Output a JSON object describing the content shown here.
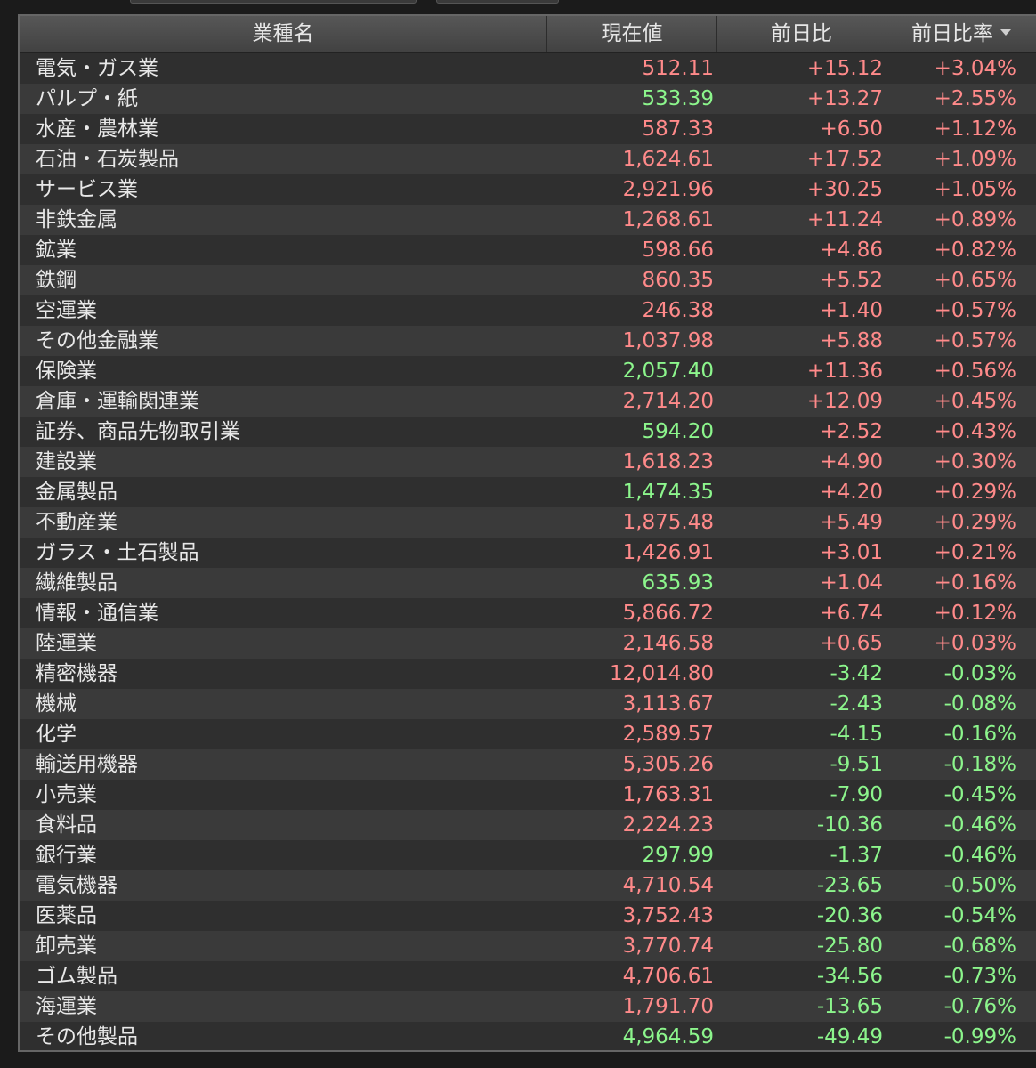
{
  "columns": {
    "name": "業種名",
    "price": "現在値",
    "change": "前日比",
    "change_pct": "前日比率"
  },
  "colors": {
    "up": "#ff8a8a",
    "down": "#8cf58c"
  },
  "rows": [
    {
      "name": "電気・ガス業",
      "price": "512.11",
      "price_dir": "up",
      "change": "+15.12",
      "change_pct": "+3.04%",
      "dir": "up"
    },
    {
      "name": "パルプ・紙",
      "price": "533.39",
      "price_dir": "down",
      "change": "+13.27",
      "change_pct": "+2.55%",
      "dir": "up"
    },
    {
      "name": "水産・農林業",
      "price": "587.33",
      "price_dir": "up",
      "change": "+6.50",
      "change_pct": "+1.12%",
      "dir": "up"
    },
    {
      "name": "石油・石炭製品",
      "price": "1,624.61",
      "price_dir": "up",
      "change": "+17.52",
      "change_pct": "+1.09%",
      "dir": "up"
    },
    {
      "name": "サービス業",
      "price": "2,921.96",
      "price_dir": "up",
      "change": "+30.25",
      "change_pct": "+1.05%",
      "dir": "up"
    },
    {
      "name": "非鉄金属",
      "price": "1,268.61",
      "price_dir": "up",
      "change": "+11.24",
      "change_pct": "+0.89%",
      "dir": "up"
    },
    {
      "name": "鉱業",
      "price": "598.66",
      "price_dir": "up",
      "change": "+4.86",
      "change_pct": "+0.82%",
      "dir": "up"
    },
    {
      "name": "鉄鋼",
      "price": "860.35",
      "price_dir": "up",
      "change": "+5.52",
      "change_pct": "+0.65%",
      "dir": "up"
    },
    {
      "name": "空運業",
      "price": "246.38",
      "price_dir": "up",
      "change": "+1.40",
      "change_pct": "+0.57%",
      "dir": "up"
    },
    {
      "name": "その他金融業",
      "price": "1,037.98",
      "price_dir": "up",
      "change": "+5.88",
      "change_pct": "+0.57%",
      "dir": "up"
    },
    {
      "name": "保険業",
      "price": "2,057.40",
      "price_dir": "down",
      "change": "+11.36",
      "change_pct": "+0.56%",
      "dir": "up"
    },
    {
      "name": "倉庫・運輸関連業",
      "price": "2,714.20",
      "price_dir": "up",
      "change": "+12.09",
      "change_pct": "+0.45%",
      "dir": "up"
    },
    {
      "name": "証券、商品先物取引業",
      "price": "594.20",
      "price_dir": "down",
      "change": "+2.52",
      "change_pct": "+0.43%",
      "dir": "up"
    },
    {
      "name": "建設業",
      "price": "1,618.23",
      "price_dir": "up",
      "change": "+4.90",
      "change_pct": "+0.30%",
      "dir": "up"
    },
    {
      "name": "金属製品",
      "price": "1,474.35",
      "price_dir": "down",
      "change": "+4.20",
      "change_pct": "+0.29%",
      "dir": "up"
    },
    {
      "name": "不動産業",
      "price": "1,875.48",
      "price_dir": "up",
      "change": "+5.49",
      "change_pct": "+0.29%",
      "dir": "up"
    },
    {
      "name": "ガラス・土石製品",
      "price": "1,426.91",
      "price_dir": "up",
      "change": "+3.01",
      "change_pct": "+0.21%",
      "dir": "up"
    },
    {
      "name": "繊維製品",
      "price": "635.93",
      "price_dir": "down",
      "change": "+1.04",
      "change_pct": "+0.16%",
      "dir": "up"
    },
    {
      "name": "情報・通信業",
      "price": "5,866.72",
      "price_dir": "up",
      "change": "+6.74",
      "change_pct": "+0.12%",
      "dir": "up"
    },
    {
      "name": "陸運業",
      "price": "2,146.58",
      "price_dir": "up",
      "change": "+0.65",
      "change_pct": "+0.03%",
      "dir": "up"
    },
    {
      "name": "精密機器",
      "price": "12,014.80",
      "price_dir": "up",
      "change": "-3.42",
      "change_pct": "-0.03%",
      "dir": "down"
    },
    {
      "name": "機械",
      "price": "3,113.67",
      "price_dir": "up",
      "change": "-2.43",
      "change_pct": "-0.08%",
      "dir": "down"
    },
    {
      "name": "化学",
      "price": "2,589.57",
      "price_dir": "up",
      "change": "-4.15",
      "change_pct": "-0.16%",
      "dir": "down"
    },
    {
      "name": "輸送用機器",
      "price": "5,305.26",
      "price_dir": "up",
      "change": "-9.51",
      "change_pct": "-0.18%",
      "dir": "down"
    },
    {
      "name": "小売業",
      "price": "1,763.31",
      "price_dir": "up",
      "change": "-7.90",
      "change_pct": "-0.45%",
      "dir": "down"
    },
    {
      "name": "食料品",
      "price": "2,224.23",
      "price_dir": "up",
      "change": "-10.36",
      "change_pct": "-0.46%",
      "dir": "down"
    },
    {
      "name": "銀行業",
      "price": "297.99",
      "price_dir": "down",
      "change": "-1.37",
      "change_pct": "-0.46%",
      "dir": "down"
    },
    {
      "name": "電気機器",
      "price": "4,710.54",
      "price_dir": "up",
      "change": "-23.65",
      "change_pct": "-0.50%",
      "dir": "down"
    },
    {
      "name": "医薬品",
      "price": "3,752.43",
      "price_dir": "up",
      "change": "-20.36",
      "change_pct": "-0.54%",
      "dir": "down"
    },
    {
      "name": "卸売業",
      "price": "3,770.74",
      "price_dir": "up",
      "change": "-25.80",
      "change_pct": "-0.68%",
      "dir": "down"
    },
    {
      "name": "ゴム製品",
      "price": "4,706.61",
      "price_dir": "up",
      "change": "-34.56",
      "change_pct": "-0.73%",
      "dir": "down"
    },
    {
      "name": "海運業",
      "price": "1,791.70",
      "price_dir": "up",
      "change": "-13.65",
      "change_pct": "-0.76%",
      "dir": "down"
    },
    {
      "name": "その他製品",
      "price": "4,964.59",
      "price_dir": "down",
      "change": "-49.49",
      "change_pct": "-0.99%",
      "dir": "down"
    }
  ]
}
